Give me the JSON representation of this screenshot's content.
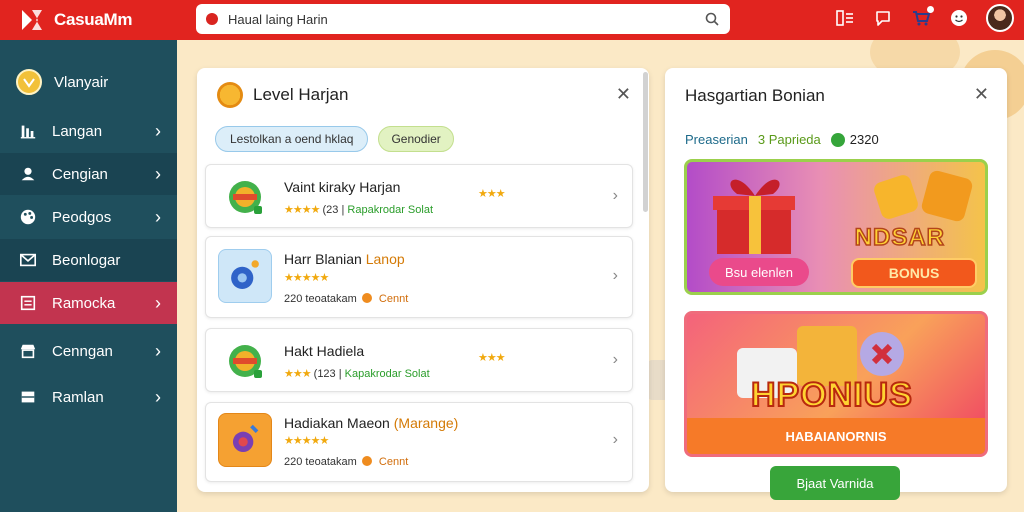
{
  "app": {
    "name": "CasuaMm"
  },
  "search": {
    "value": "Haual laing Harin"
  },
  "sidebar": {
    "brand": "Vlanyair",
    "items": [
      {
        "label": "Langan",
        "icon": "building-icon"
      },
      {
        "label": "Cengian",
        "icon": "user-icon"
      },
      {
        "label": "Peodgos",
        "icon": "palette-icon"
      },
      {
        "label": "Beonlogar",
        "icon": "mail-icon"
      },
      {
        "label": "Ramocka",
        "icon": "list-icon",
        "active": true
      },
      {
        "label": "Cenngan",
        "icon": "shop-icon"
      },
      {
        "label": "Ramlan",
        "icon": "grid-icon"
      }
    ]
  },
  "left_panel": {
    "title": "Level Harjan",
    "filter_primary": "Lestolkan a oend hklaq",
    "filter_secondary": "Genodier",
    "games": [
      {
        "name": "Vaint kiraky Harjan",
        "stars": "★★★★",
        "rating_stars": "★★★",
        "meta_prefix": "(23 |",
        "meta_tail": "Rapakrodar Solat"
      },
      {
        "name": "Harr Blanian",
        "name_accent": "Lanop",
        "stars": "★★★★★",
        "count": "220",
        "meta_label": "teoatakam",
        "coin_label": "Cennt"
      },
      {
        "name": "Hakt Hadiela",
        "stars": "★★★",
        "rating_stars": "★★★",
        "meta_prefix": "(123 |",
        "meta_tail": "Kapakrodar Solat"
      },
      {
        "name": "Hadiakan Maeon",
        "name_accent": "(Marange)",
        "stars": "★★★★★",
        "count": "220",
        "meta_label": "teoatakam",
        "coin_label": "Cennt"
      }
    ]
  },
  "right_panel": {
    "title": "Hasgartian Bonian",
    "stat1": "Preaserian",
    "stat2": "3 Paprieda",
    "stat3": "2320",
    "promo1_word": "NDSAR",
    "promo1_label": "Bsu elenlen",
    "promo1_button": "BONUS",
    "promo2_word": "HPONIUS",
    "promo2_bar": "HABAIANORNIS",
    "claim_button": "Bjaat Varnida"
  },
  "colors": {
    "topbar": "#e1241f",
    "sidebar": "#1f4f5d",
    "sidebar_active": "#c2344f",
    "claim": "#38a53a"
  }
}
